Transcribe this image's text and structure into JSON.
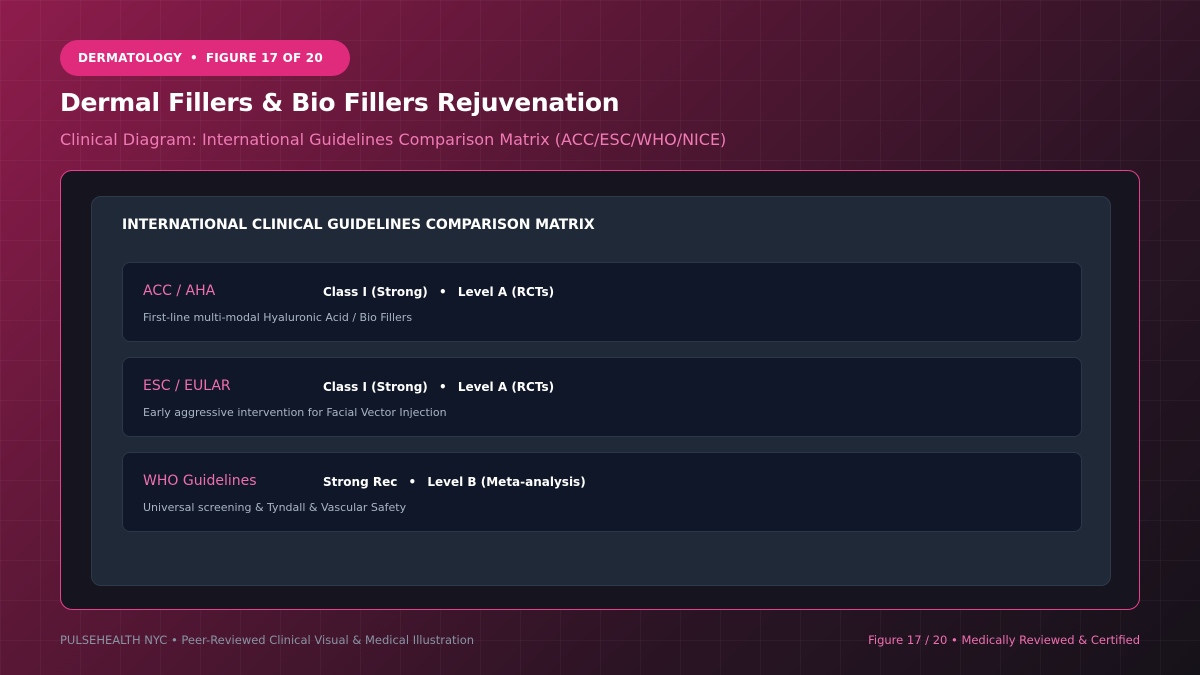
{
  "badge": {
    "category": "DERMATOLOGY",
    "separator": "•",
    "figure": "FIGURE 17 OF 20"
  },
  "header": {
    "title": "Dermal Fillers & Bio Fillers Rejuvenation",
    "subtitle": "Clinical Diagram: International Guidelines Comparison Matrix (ACC/ESC/WHO/NICE)"
  },
  "matrix": {
    "heading": "INTERNATIONAL CLINICAL GUIDELINES COMPARISON MATRIX",
    "rows": [
      {
        "org": "ACC / AHA",
        "recommendation": "Class I (Strong)",
        "separator": "•",
        "evidence": "Level A (RCTs)",
        "description": "First-line multi-modal Hyaluronic Acid / Bio Fillers"
      },
      {
        "org": "ESC / EULAR",
        "recommendation": "Class I (Strong)",
        "separator": "•",
        "evidence": "Level A (RCTs)",
        "description": "Early aggressive intervention for Facial Vector Injection"
      },
      {
        "org": "WHO Guidelines",
        "recommendation": "Strong Rec",
        "separator": "•",
        "evidence": "Level B (Meta-analysis)",
        "description": "Universal screening & Tyndall & Vascular Safety"
      }
    ]
  },
  "footer": {
    "left": "PULSEHEALTH NYC  •  Peer-Reviewed Clinical Visual & Medical Illustration",
    "right": "Figure 17 / 20  •  Medically Reviewed & Certified"
  },
  "colors": {
    "accent": "#e02b7c",
    "accent_text": "#f06fb0",
    "panel": "#1f2937",
    "row": "#0f1729"
  }
}
